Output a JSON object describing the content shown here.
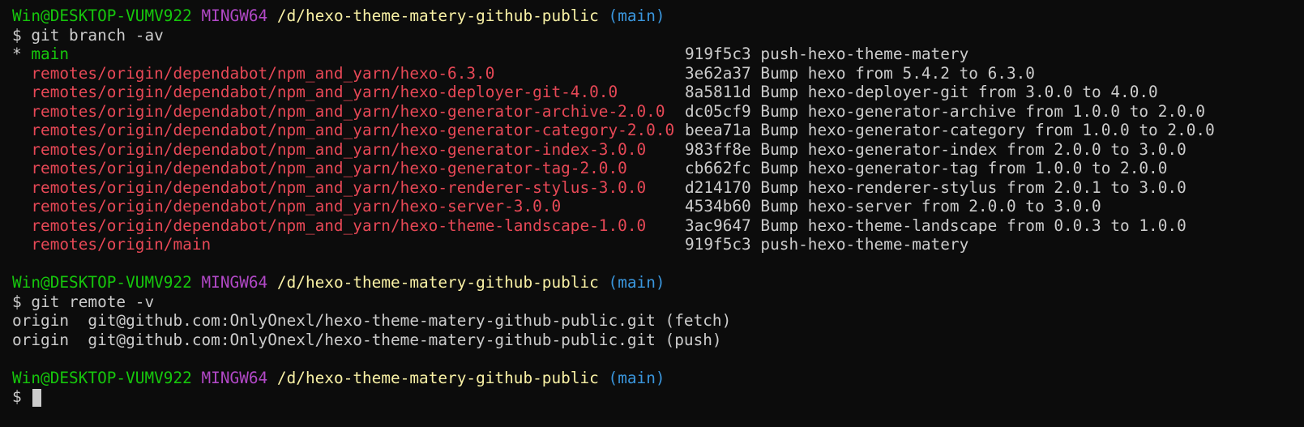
{
  "colors": {
    "background": "#0c0c0c",
    "text": "#cccccc",
    "user_host": "#16c60c",
    "shell": "#b148c6",
    "path": "#f9f1a5",
    "branch": "#3a96dd",
    "remote_branch": "#e74856",
    "current_branch": "#16c60c"
  },
  "prompts": [
    {
      "user_host": "Win@DESKTOP-VUMV922",
      "shell": "MINGW64",
      "path": "/d/hexo-theme-matery-github-public",
      "branch": "(main)",
      "command": "$ git branch -av"
    },
    {
      "user_host": "Win@DESKTOP-VUMV922",
      "shell": "MINGW64",
      "path": "/d/hexo-theme-matery-github-public",
      "branch": "(main)",
      "command": "$ git remote -v"
    },
    {
      "user_host": "Win@DESKTOP-VUMV922",
      "shell": "MINGW64",
      "path": "/d/hexo-theme-matery-github-public",
      "branch": "(main)",
      "command": "$"
    }
  ],
  "branches": [
    {
      "prefix": "* ",
      "name": "main",
      "hash": "919f5c3",
      "message": "push-hexo-theme-matery",
      "current": true
    },
    {
      "prefix": "  ",
      "name": "remotes/origin/dependabot/npm_and_yarn/hexo-6.3.0",
      "hash": "3e62a37",
      "message": "Bump hexo from 5.4.2 to 6.3.0",
      "current": false
    },
    {
      "prefix": "  ",
      "name": "remotes/origin/dependabot/npm_and_yarn/hexo-deployer-git-4.0.0",
      "hash": "8a5811d",
      "message": "Bump hexo-deployer-git from 3.0.0 to 4.0.0",
      "current": false
    },
    {
      "prefix": "  ",
      "name": "remotes/origin/dependabot/npm_and_yarn/hexo-generator-archive-2.0.0",
      "hash": "dc05cf9",
      "message": "Bump hexo-generator-archive from 1.0.0 to 2.0.0",
      "current": false
    },
    {
      "prefix": "  ",
      "name": "remotes/origin/dependabot/npm_and_yarn/hexo-generator-category-2.0.0",
      "hash": "beea71a",
      "message": "Bump hexo-generator-category from 1.0.0 to 2.0.0",
      "current": false
    },
    {
      "prefix": "  ",
      "name": "remotes/origin/dependabot/npm_and_yarn/hexo-generator-index-3.0.0",
      "hash": "983ff8e",
      "message": "Bump hexo-generator-index from 2.0.0 to 3.0.0",
      "current": false
    },
    {
      "prefix": "  ",
      "name": "remotes/origin/dependabot/npm_and_yarn/hexo-generator-tag-2.0.0",
      "hash": "cb662fc",
      "message": "Bump hexo-generator-tag from 1.0.0 to 2.0.0",
      "current": false
    },
    {
      "prefix": "  ",
      "name": "remotes/origin/dependabot/npm_and_yarn/hexo-renderer-stylus-3.0.0",
      "hash": "d214170",
      "message": "Bump hexo-renderer-stylus from 2.0.1 to 3.0.0",
      "current": false
    },
    {
      "prefix": "  ",
      "name": "remotes/origin/dependabot/npm_and_yarn/hexo-server-3.0.0",
      "hash": "4534b60",
      "message": "Bump hexo-server from 2.0.0 to 3.0.0",
      "current": false
    },
    {
      "prefix": "  ",
      "name": "remotes/origin/dependabot/npm_and_yarn/hexo-theme-landscape-1.0.0",
      "hash": "3ac9647",
      "message": "Bump hexo-theme-landscape from 0.0.3 to 1.0.0",
      "current": false
    },
    {
      "prefix": "  ",
      "name": "remotes/origin/main",
      "hash": "919f5c3",
      "message": "push-hexo-theme-matery",
      "current": false
    }
  ],
  "remotes": [
    {
      "name": "origin",
      "url": "git@github.com:OnlyOnexl/hexo-theme-matery-github-public.git",
      "type": "(fetch)"
    },
    {
      "name": "origin",
      "url": "git@github.com:OnlyOnexl/hexo-theme-matery-github-public.git",
      "type": "(push)"
    }
  ]
}
